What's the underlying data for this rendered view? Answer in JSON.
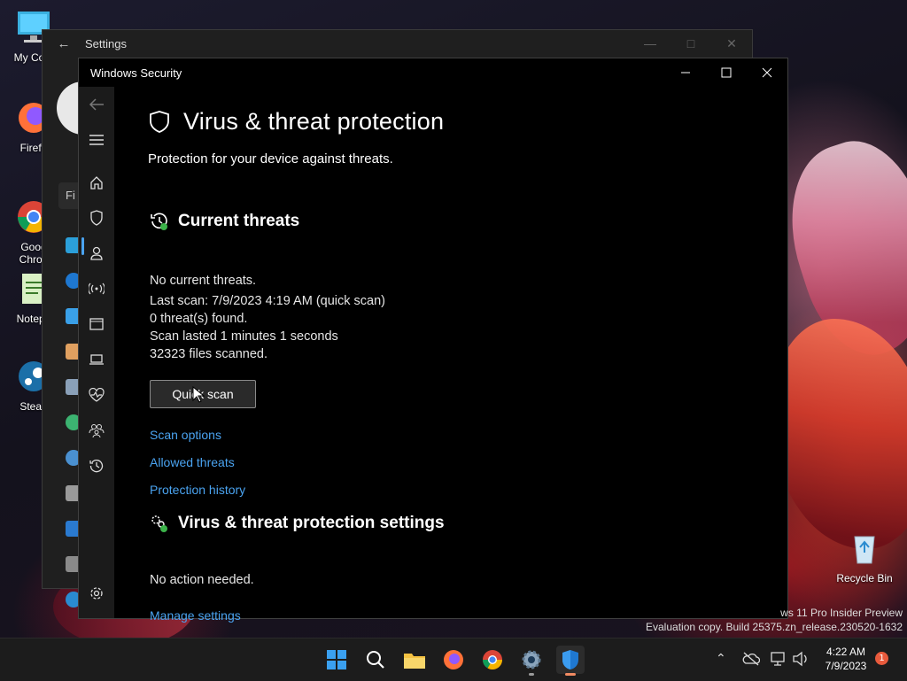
{
  "desktop": {
    "icons": [
      {
        "label": "My Com"
      },
      {
        "label": "Firefo"
      },
      {
        "label": "Goog\nChron"
      },
      {
        "label": "Notepa"
      },
      {
        "label": "Stean"
      },
      {
        "label": "Recycle Bin"
      }
    ],
    "watermark": {
      "line1": "ws 11 Pro Insider Preview",
      "line2": "Evaluation copy. Build 25375.zn_release.230520-1632"
    }
  },
  "settings_window": {
    "title": "Settings",
    "search_partial": "Fi"
  },
  "security_window": {
    "title": "Windows Security",
    "page_title": "Virus & threat protection",
    "page_subtitle": "Protection for your device against threats.",
    "current_threats": {
      "heading": "Current threats",
      "lines": [
        "No current threats.",
        "Last scan: 7/9/2023 4:19 AM (quick scan)",
        "0 threat(s) found.",
        "Scan lasted 1 minutes 1 seconds",
        "32323 files scanned."
      ],
      "button": "Quick scan",
      "links": [
        "Scan options",
        "Allowed threats",
        "Protection history"
      ]
    },
    "settings_section": {
      "heading": "Virus & threat protection settings",
      "status": "No action needed.",
      "link": "Manage settings"
    },
    "nav_icons": [
      "back-icon",
      "menu-icon",
      "home-icon",
      "shield-icon",
      "account-icon",
      "firewall-icon",
      "app-browser-icon",
      "device-security-icon",
      "health-icon",
      "family-icon",
      "history-icon",
      "settings-gear-icon"
    ]
  },
  "taskbar": {
    "apps": [
      "start",
      "search",
      "file-explorer",
      "firefox",
      "chrome",
      "settings",
      "windows-security"
    ],
    "clock_time": "4:22 AM",
    "clock_date": "7/9/2023",
    "notification_count": "1"
  },
  "colors": {
    "accent_link": "#4aa3f0",
    "window_bg": "#000000",
    "rail_bg": "#1b1b1b",
    "notification": "#e85a3c"
  }
}
